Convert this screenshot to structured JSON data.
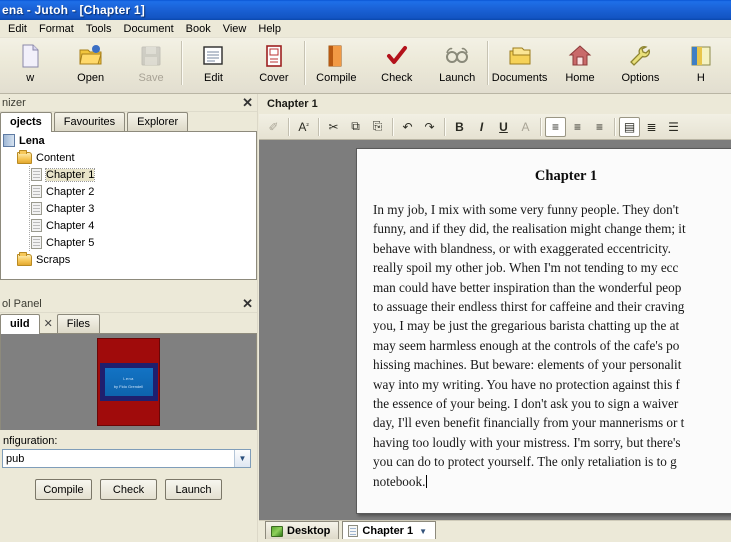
{
  "window": {
    "title": "ena - Jutoh - [Chapter 1]"
  },
  "menubar": {
    "items": [
      {
        "label": "Edit"
      },
      {
        "label": "Format"
      },
      {
        "label": "Tools"
      },
      {
        "label": "Document"
      },
      {
        "label": "Book"
      },
      {
        "label": "View"
      },
      {
        "label": "Help"
      }
    ]
  },
  "toolbar": {
    "buttons": [
      {
        "label": "w",
        "icon": "new-document-icon",
        "enabled": true
      },
      {
        "label": "Open",
        "icon": "open-folder-icon",
        "enabled": true
      },
      {
        "label": "Save",
        "icon": "save-disk-icon",
        "enabled": false
      },
      {
        "label": "Edit",
        "icon": "edit-page-icon",
        "enabled": true
      },
      {
        "label": "Cover",
        "icon": "cover-icon",
        "enabled": true
      },
      {
        "label": "Compile",
        "icon": "compile-book-icon",
        "enabled": true
      },
      {
        "label": "Check",
        "icon": "check-tick-icon",
        "enabled": true
      },
      {
        "label": "Launch",
        "icon": "glasses-launch-icon",
        "enabled": true
      },
      {
        "label": "Documents",
        "icon": "documents-icon",
        "enabled": true
      },
      {
        "label": "Home",
        "icon": "home-icon",
        "enabled": true
      },
      {
        "label": "Options",
        "icon": "wrench-options-icon",
        "enabled": true
      },
      {
        "label": "H",
        "icon": "help-book-icon",
        "enabled": true
      }
    ]
  },
  "organizer": {
    "caption": "nizer",
    "close_label": "✕",
    "tabs": [
      {
        "label": "ojects",
        "active": true
      },
      {
        "label": "Favourites",
        "active": false
      },
      {
        "label": "Explorer",
        "active": false
      }
    ],
    "tree": [
      {
        "label": "Lena",
        "icon": "book-icon",
        "depth": 0,
        "selected": false,
        "root": true
      },
      {
        "label": "Content",
        "icon": "folder-icon",
        "depth": 1,
        "selected": false,
        "root": false
      },
      {
        "label": "Chapter 1",
        "icon": "document-icon",
        "depth": 2,
        "selected": true,
        "root": false
      },
      {
        "label": "Chapter 2",
        "icon": "document-icon",
        "depth": 2,
        "selected": false,
        "root": false
      },
      {
        "label": "Chapter 3",
        "icon": "document-icon",
        "depth": 2,
        "selected": false,
        "root": false
      },
      {
        "label": "Chapter 4",
        "icon": "document-icon",
        "depth": 2,
        "selected": false,
        "root": false
      },
      {
        "label": "Chapter 5",
        "icon": "document-icon",
        "depth": 2,
        "selected": false,
        "root": false
      },
      {
        "label": "Scraps",
        "icon": "folder-icon",
        "depth": 1,
        "selected": false,
        "root": false
      }
    ]
  },
  "control_panel": {
    "caption": "ol Panel",
    "close_label": "✕",
    "tabs": [
      {
        "label": "uild",
        "active": true
      },
      {
        "label": "Files",
        "active": false
      }
    ],
    "tab_close_label": "✕",
    "cover": {
      "title_line1": "Lena",
      "title_line2": "by Fido Grendell"
    },
    "configuration_label": "nfiguration:",
    "configuration_value": "pub",
    "dropdown_arrow": "▼",
    "buttons": [
      {
        "label": "Compile"
      },
      {
        "label": "Check"
      },
      {
        "label": "Launch"
      }
    ]
  },
  "document": {
    "caption": "Chapter 1",
    "format_toolbar": [
      {
        "icon": "highlighter-icon",
        "glyph": "✐",
        "state": "dim"
      },
      {
        "sep": true
      },
      {
        "icon": "font-size-icon",
        "glyph": "A",
        "sup": "²",
        "state": "normal"
      },
      {
        "sep": true
      },
      {
        "icon": "cut-scissors-icon",
        "glyph": "✂",
        "state": "normal"
      },
      {
        "icon": "copy-icon",
        "glyph": "⧉",
        "state": "normal"
      },
      {
        "icon": "paste-icon",
        "glyph": "⎘",
        "state": "normal"
      },
      {
        "sep": true
      },
      {
        "icon": "undo-icon",
        "glyph": "↶",
        "state": "normal"
      },
      {
        "icon": "redo-icon",
        "glyph": "↷",
        "state": "normal"
      },
      {
        "sep": true
      },
      {
        "icon": "bold-icon",
        "glyph": "B",
        "state": "bold"
      },
      {
        "icon": "italic-icon",
        "glyph": "I",
        "state": "italic"
      },
      {
        "icon": "underline-icon",
        "glyph": "U",
        "state": "underline"
      },
      {
        "icon": "font-colour-icon",
        "glyph": "A",
        "state": "dim"
      },
      {
        "sep": true
      },
      {
        "icon": "align-left-icon",
        "glyph": "≡",
        "state": "pressed"
      },
      {
        "icon": "align-center-icon",
        "glyph": "≡",
        "state": "normal"
      },
      {
        "icon": "align-right-icon",
        "glyph": "≡",
        "state": "normal"
      },
      {
        "sep": true
      },
      {
        "icon": "indent-icon",
        "glyph": "▤",
        "state": "pressed"
      },
      {
        "icon": "list-bullet-icon",
        "glyph": "≣",
        "state": "normal"
      },
      {
        "icon": "list-number-icon",
        "glyph": "☰",
        "state": "normal"
      }
    ],
    "page": {
      "heading": "Chapter 1",
      "body": "In my job, I mix with some very funny people. They don't\nfunny, and if they did, the realisation might change them; it\nbehave with blandness, or with exaggerated eccentricity. \nreally spoil my other job. When I'm not tending to my ecc\nman could have better inspiration than the wonderful peop\nto assuage their endless thirst for caffeine and their craving\nyou, I may be just the gregarious barista chatting up the at\nmay seem harmless enough at the controls of the cafe's po\nhissing machines. But beware: elements of your personalit\nway into my writing. You have no protection against this f\nthe essence of your being. I don't ask you to sign a waiver\nday, I'll even benefit financially from your mannerisms or t\nhaving too loudly with your mistress. I'm sorry, but there's\nyou can do to protect yourself. The only retaliation is to g\nnotebook."
    }
  },
  "bottom_tabs": [
    {
      "label": "Desktop",
      "icon": "desktop-icon",
      "active": false,
      "dropdown": false
    },
    {
      "label": "Chapter 1",
      "icon": "page-icon",
      "active": true,
      "dropdown": true,
      "dropdown_glyph": "▼"
    }
  ],
  "colors": {
    "titlebar": "#1b63d8",
    "chrome": "#ece9d8",
    "doc_surface": "#7d7d7d",
    "page": "#fbfbfb",
    "cover_red": "#a00b0b",
    "cover_blue": "#1273c4"
  }
}
